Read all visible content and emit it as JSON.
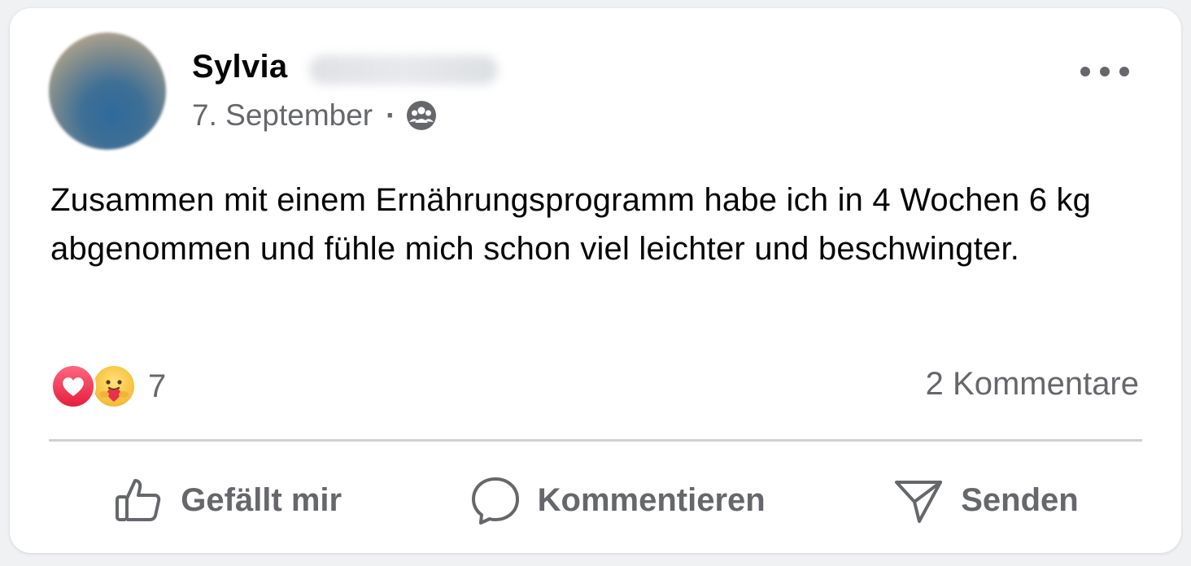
{
  "post": {
    "author_first_name": "Sylvia",
    "date": "7. September",
    "separator": "·",
    "audience_icon": "group-icon",
    "text": "Zusammen mit einem Ernährungsprogramm habe ich in 4 Wochen 6 kg abgenommen und fühle mich schon viel leichter und beschwingter.",
    "reactions": {
      "icons": [
        "love-reaction-icon",
        "care-reaction-icon"
      ],
      "count": "7"
    },
    "comments_label": "2 Kommentare"
  },
  "actions": {
    "like_label": "Gefällt mir",
    "comment_label": "Kommentieren",
    "send_label": "Senden"
  },
  "colors": {
    "secondary_text": "#65676b",
    "primary_text": "#050505",
    "love": "#e61e3c",
    "care": "#f7c340"
  }
}
